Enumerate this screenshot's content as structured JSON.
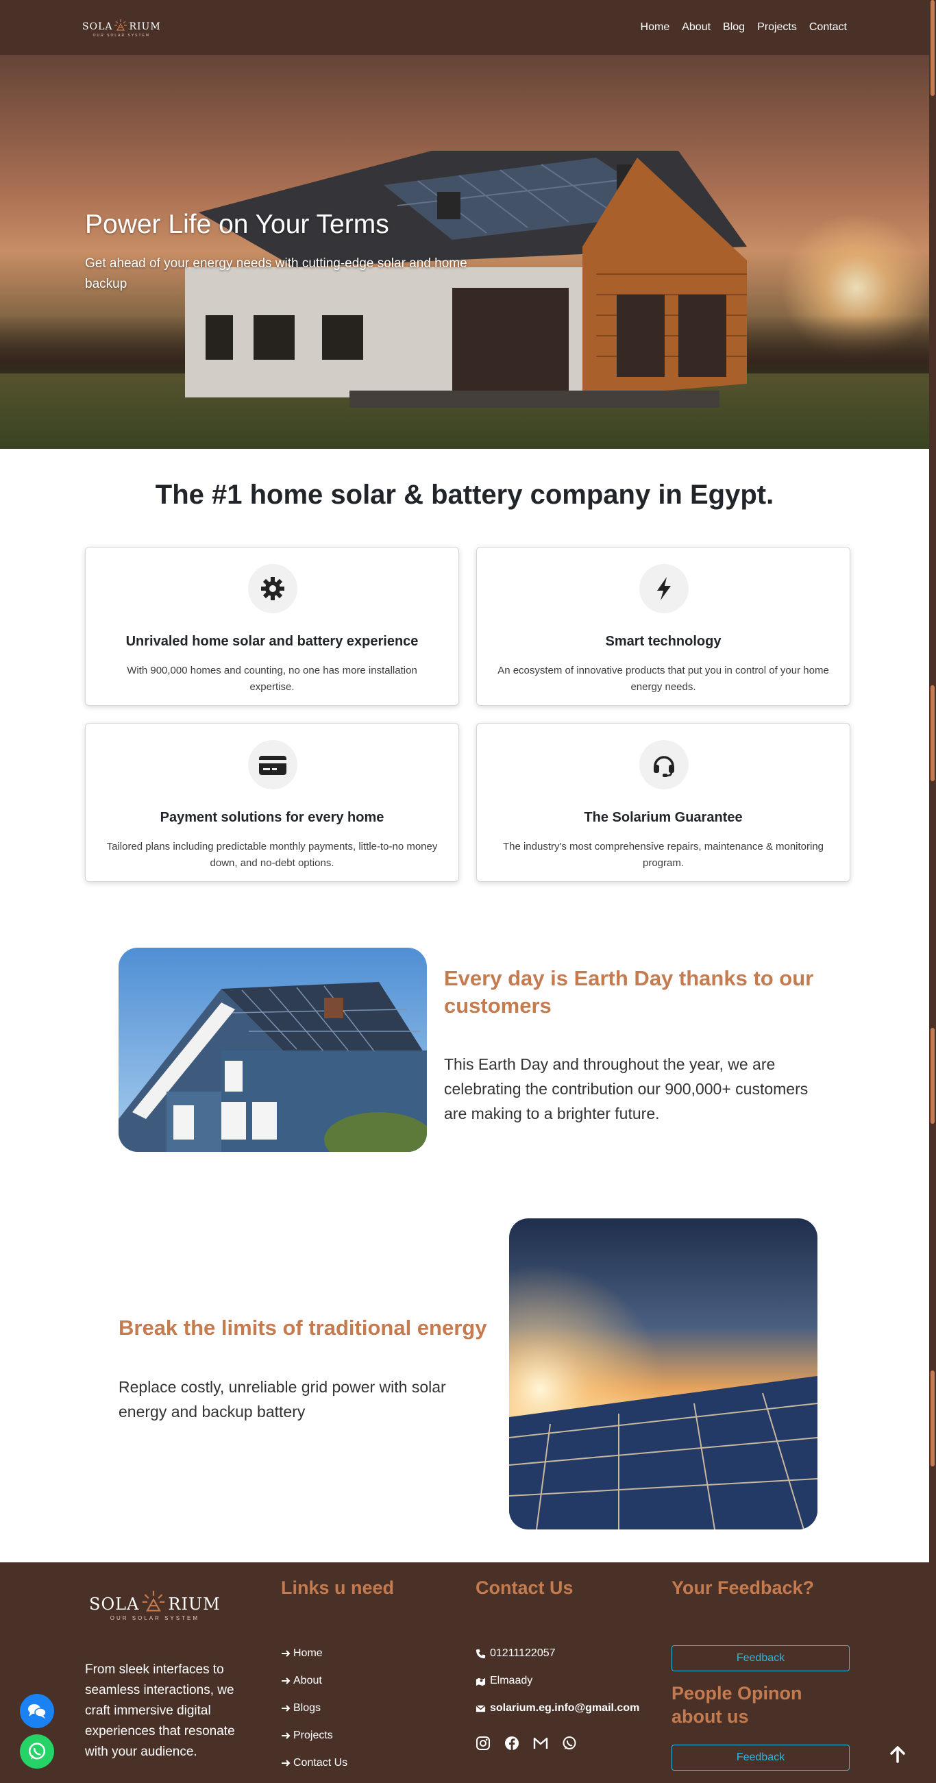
{
  "nav": {
    "logo_left": "SOLA",
    "logo_right": "RIUM",
    "logo_tagline": "OUR SOLAR SYSTEM",
    "links": [
      "Home",
      "About",
      "Blog",
      "Projects",
      "Contact"
    ]
  },
  "hero": {
    "title": "Power Life on Your Terms",
    "subtitle": "Get ahead of your energy needs with cutting-edge solar and home backup"
  },
  "features": {
    "heading": "The #1 home solar & battery company in Egypt.",
    "cards": [
      {
        "icon": "gear-icon",
        "title": "Unrivaled home solar and battery experience",
        "text": "With 900,000 homes and counting, no one has more installation expertise."
      },
      {
        "icon": "lightning-icon",
        "title": "Smart technology",
        "text": "An ecosystem of innovative products that put you in control of your home energy needs."
      },
      {
        "icon": "credit-card-icon",
        "title": "Payment solutions for every home",
        "text": "Tailored plans including predictable monthly payments, little-to-no money down, and no-debt options."
      },
      {
        "icon": "headset-icon",
        "title": "The Solarium Guarantee",
        "text": "The industry's most comprehensive repairs, maintenance & monitoring program."
      }
    ]
  },
  "earth_day": {
    "title": "Every day is Earth Day thanks to our customers",
    "text": "This Earth Day and throughout the year, we are celebrating the contribution our 900,000+ customers are making to a brighter future."
  },
  "break_limits": {
    "title": "Break the limits of traditional energy",
    "text": "Replace costly, unreliable grid power with solar energy and backup battery"
  },
  "footer": {
    "about": "From sleek interfaces to seamless interactions, we craft immersive digital experiences that resonate with your audience.",
    "links_heading": "Links u need",
    "links": [
      "Home",
      "About",
      "Blogs",
      "Projects",
      "Contact Us"
    ],
    "contact_heading": "Contact Us",
    "phone": "01211122057",
    "address": "Elmaady",
    "email": "solarium.eg.info@gmail.com",
    "feedback_heading": "Your Feedback?",
    "feedback_button": "Feedback",
    "opinion_heading": "People Opinon about us",
    "opinion_button": "Feedback"
  },
  "colors": {
    "brand_brown": "#4a3128",
    "accent_orange": "#c47b4f",
    "button_blue": "#2fb7e0"
  }
}
